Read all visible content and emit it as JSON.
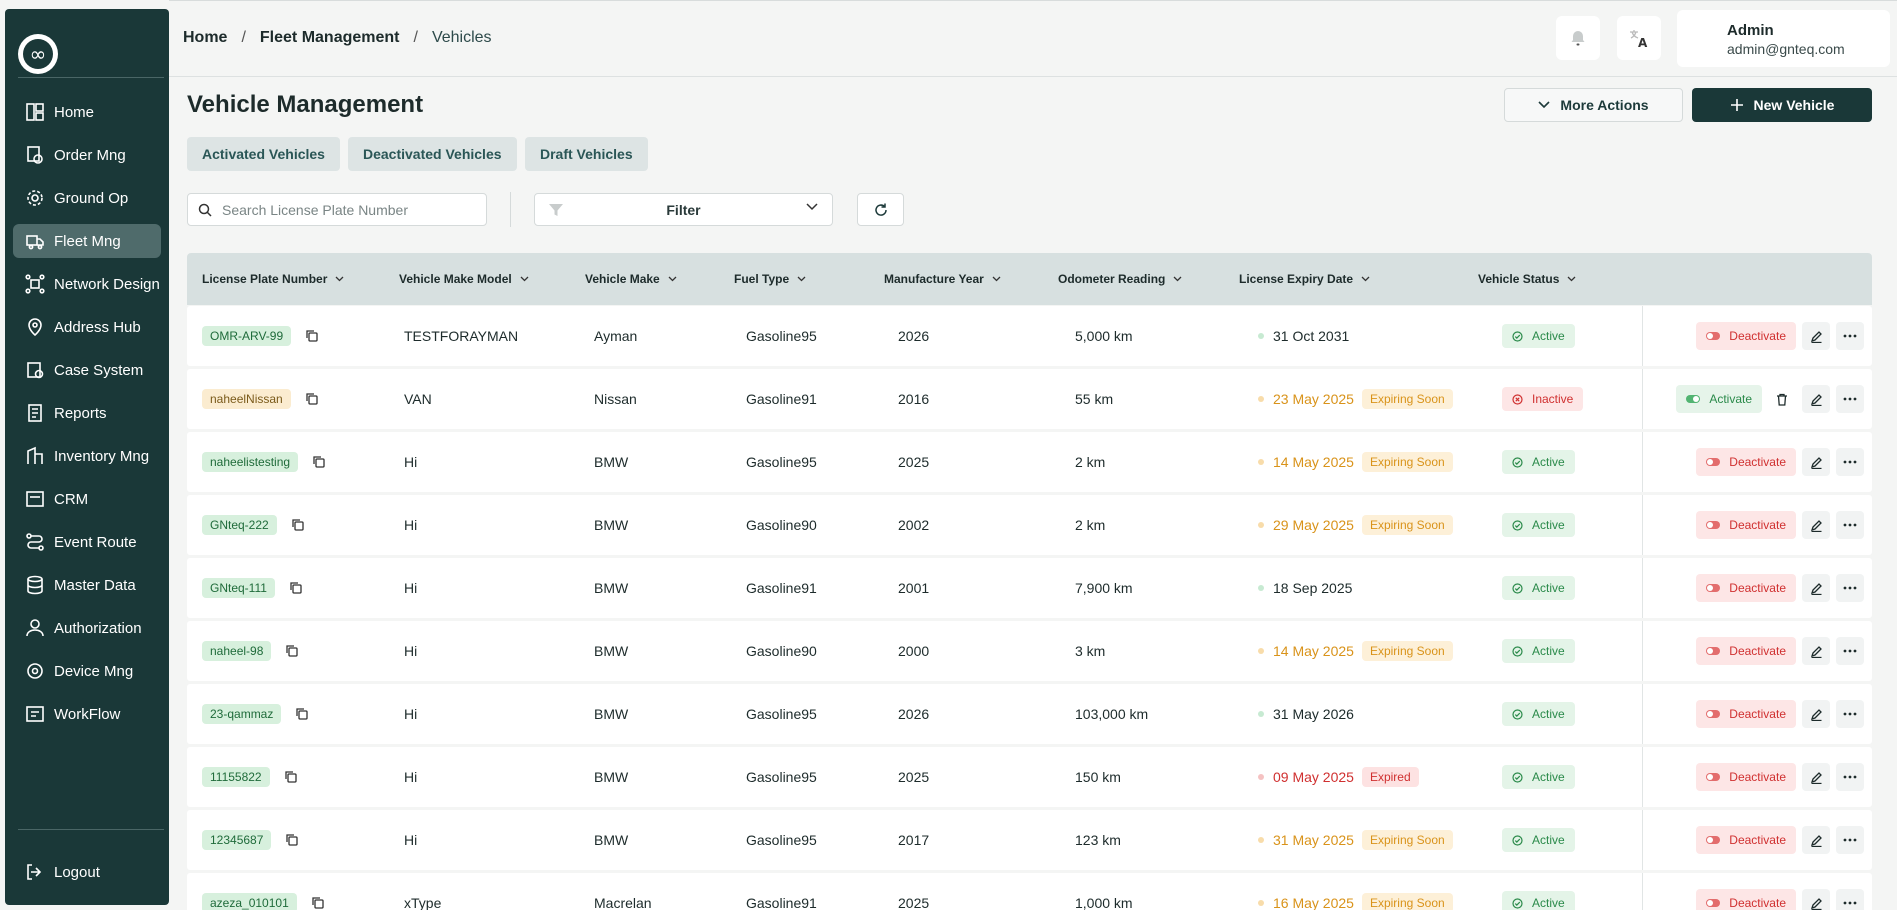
{
  "app": {
    "logo_glyph": "∞"
  },
  "breadcrumb": {
    "home": "Home",
    "section": "Fleet Management",
    "current": "Vehicles",
    "sep": "/"
  },
  "user": {
    "name": "Admin",
    "email": "admin@gnteq.com",
    "avatar_letter": "A"
  },
  "sidebar": {
    "items": [
      {
        "label": "Home",
        "icon": "home-icon"
      },
      {
        "label": "Order Mng",
        "icon": "order-icon"
      },
      {
        "label": "Ground Op",
        "icon": "ground-op-icon"
      },
      {
        "label": "Fleet Mng",
        "icon": "truck-icon",
        "active": true
      },
      {
        "label": "Network Design",
        "icon": "network-icon"
      },
      {
        "label": "Address Hub",
        "icon": "location-icon"
      },
      {
        "label": "Case System",
        "icon": "case-icon"
      },
      {
        "label": "Reports",
        "icon": "report-icon"
      },
      {
        "label": "Inventory Mng",
        "icon": "inventory-icon"
      },
      {
        "label": "CRM",
        "icon": "crm-icon"
      },
      {
        "label": "Event Route",
        "icon": "route-icon"
      },
      {
        "label": "Master Data",
        "icon": "database-icon"
      },
      {
        "label": "Authorization",
        "icon": "user-icon"
      },
      {
        "label": "Device Mng",
        "icon": "device-icon"
      },
      {
        "label": "WorkFlow",
        "icon": "workflow-icon"
      }
    ],
    "logout": "Logout"
  },
  "page": {
    "title": "Vehicle Management",
    "more_actions": "More Actions",
    "new_vehicle": "New Vehicle",
    "tabs": [
      "Activated Vehicles",
      "Deactivated Vehicles",
      "Draft Vehicles"
    ],
    "search_placeholder": "Search License Plate Number",
    "filter_label": "Filter"
  },
  "table": {
    "columns": [
      "License Plate Number",
      "Vehicle Make Model",
      "Vehicle Make",
      "Fuel Type",
      "Manufacture Year",
      "Odometer Reading",
      "License Expiry Date",
      "Vehicle Status"
    ],
    "rows": [
      {
        "plate": "OMR-ARV-99",
        "plate_tone": "green",
        "model": "TESTFORAYMAN",
        "make": "Ayman",
        "fuel": "Gasoline95",
        "year": "2026",
        "odometer": "5,000 km",
        "expiry": "31 Oct 2031",
        "expiry_state": "ok",
        "expiry_badge": "",
        "status": "Active",
        "action": "Deactivate"
      },
      {
        "plate": "naheelNissan",
        "plate_tone": "amber",
        "model": "VAN",
        "make": "Nissan",
        "fuel": "Gasoline91",
        "year": "2016",
        "odometer": "55 km",
        "expiry": "23 May 2025",
        "expiry_state": "soon",
        "expiry_badge": "Expiring Soon",
        "status": "Inactive",
        "action": "Activate"
      },
      {
        "plate": "naheelistesting",
        "plate_tone": "green",
        "model": "Hi",
        "make": "BMW",
        "fuel": "Gasoline95",
        "year": "2025",
        "odometer": "2 km",
        "expiry": "14 May 2025",
        "expiry_state": "soon",
        "expiry_badge": "Expiring Soon",
        "status": "Active",
        "action": "Deactivate"
      },
      {
        "plate": "GNteq-222",
        "plate_tone": "green",
        "model": "Hi",
        "make": "BMW",
        "fuel": "Gasoline90",
        "year": "2002",
        "odometer": "2 km",
        "expiry": "29 May 2025",
        "expiry_state": "soon",
        "expiry_badge": "Expiring Soon",
        "status": "Active",
        "action": "Deactivate"
      },
      {
        "plate": "GNteq-111",
        "plate_tone": "green",
        "model": "Hi",
        "make": "BMW",
        "fuel": "Gasoline91",
        "year": "2001",
        "odometer": "7,900 km",
        "expiry": "18 Sep 2025",
        "expiry_state": "ok",
        "expiry_badge": "",
        "status": "Active",
        "action": "Deactivate"
      },
      {
        "plate": "naheel-98",
        "plate_tone": "green",
        "model": "Hi",
        "make": "BMW",
        "fuel": "Gasoline90",
        "year": "2000",
        "odometer": "3 km",
        "expiry": "14 May 2025",
        "expiry_state": "soon",
        "expiry_badge": "Expiring Soon",
        "status": "Active",
        "action": "Deactivate"
      },
      {
        "plate": "23-qammaz",
        "plate_tone": "green",
        "model": "Hi",
        "make": "BMW",
        "fuel": "Gasoline95",
        "year": "2026",
        "odometer": "103,000 km",
        "expiry": "31 May 2026",
        "expiry_state": "ok",
        "expiry_badge": "",
        "status": "Active",
        "action": "Deactivate"
      },
      {
        "plate": "11155822",
        "plate_tone": "green",
        "model": "Hi",
        "make": "BMW",
        "fuel": "Gasoline95",
        "year": "2025",
        "odometer": "150 km",
        "expiry": "09 May 2025",
        "expiry_state": "expired",
        "expiry_badge": "Expired",
        "status": "Active",
        "action": "Deactivate"
      },
      {
        "plate": "12345687",
        "plate_tone": "green",
        "model": "Hi",
        "make": "BMW",
        "fuel": "Gasoline95",
        "year": "2017",
        "odometer": "123 km",
        "expiry": "31 May 2025",
        "expiry_state": "soon",
        "expiry_badge": "Expiring Soon",
        "status": "Active",
        "action": "Deactivate"
      },
      {
        "plate": "azeza_010101",
        "plate_tone": "green",
        "model": "xType",
        "make": "Macrelan",
        "fuel": "Gasoline91",
        "year": "2025",
        "odometer": "1,000 km",
        "expiry": "16 May 2025",
        "expiry_state": "soon",
        "expiry_badge": "Expiring Soon",
        "status": "Active",
        "action": "Deactivate"
      }
    ]
  },
  "colors": {
    "sidebar_bg": "#1a3838",
    "primary": "#1a3838",
    "success": "#2a8a4a",
    "danger": "#d03030",
    "warning": "#d9931a"
  }
}
